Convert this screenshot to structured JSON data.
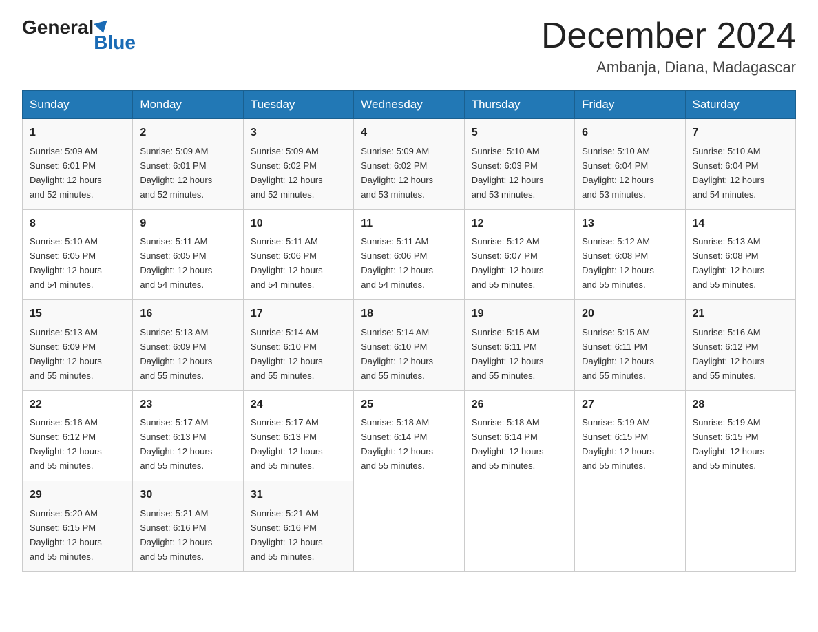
{
  "header": {
    "logo_general": "General",
    "logo_blue": "Blue",
    "month_title": "December 2024",
    "location": "Ambanja, Diana, Madagascar"
  },
  "days_of_week": [
    "Sunday",
    "Monday",
    "Tuesday",
    "Wednesday",
    "Thursday",
    "Friday",
    "Saturday"
  ],
  "weeks": [
    [
      {
        "day": "1",
        "sunrise": "5:09 AM",
        "sunset": "6:01 PM",
        "daylight": "12 hours and 52 minutes."
      },
      {
        "day": "2",
        "sunrise": "5:09 AM",
        "sunset": "6:01 PM",
        "daylight": "12 hours and 52 minutes."
      },
      {
        "day": "3",
        "sunrise": "5:09 AM",
        "sunset": "6:02 PM",
        "daylight": "12 hours and 52 minutes."
      },
      {
        "day": "4",
        "sunrise": "5:09 AM",
        "sunset": "6:02 PM",
        "daylight": "12 hours and 53 minutes."
      },
      {
        "day": "5",
        "sunrise": "5:10 AM",
        "sunset": "6:03 PM",
        "daylight": "12 hours and 53 minutes."
      },
      {
        "day": "6",
        "sunrise": "5:10 AM",
        "sunset": "6:04 PM",
        "daylight": "12 hours and 53 minutes."
      },
      {
        "day": "7",
        "sunrise": "5:10 AM",
        "sunset": "6:04 PM",
        "daylight": "12 hours and 54 minutes."
      }
    ],
    [
      {
        "day": "8",
        "sunrise": "5:10 AM",
        "sunset": "6:05 PM",
        "daylight": "12 hours and 54 minutes."
      },
      {
        "day": "9",
        "sunrise": "5:11 AM",
        "sunset": "6:05 PM",
        "daylight": "12 hours and 54 minutes."
      },
      {
        "day": "10",
        "sunrise": "5:11 AM",
        "sunset": "6:06 PM",
        "daylight": "12 hours and 54 minutes."
      },
      {
        "day": "11",
        "sunrise": "5:11 AM",
        "sunset": "6:06 PM",
        "daylight": "12 hours and 54 minutes."
      },
      {
        "day": "12",
        "sunrise": "5:12 AM",
        "sunset": "6:07 PM",
        "daylight": "12 hours and 55 minutes."
      },
      {
        "day": "13",
        "sunrise": "5:12 AM",
        "sunset": "6:08 PM",
        "daylight": "12 hours and 55 minutes."
      },
      {
        "day": "14",
        "sunrise": "5:13 AM",
        "sunset": "6:08 PM",
        "daylight": "12 hours and 55 minutes."
      }
    ],
    [
      {
        "day": "15",
        "sunrise": "5:13 AM",
        "sunset": "6:09 PM",
        "daylight": "12 hours and 55 minutes."
      },
      {
        "day": "16",
        "sunrise": "5:13 AM",
        "sunset": "6:09 PM",
        "daylight": "12 hours and 55 minutes."
      },
      {
        "day": "17",
        "sunrise": "5:14 AM",
        "sunset": "6:10 PM",
        "daylight": "12 hours and 55 minutes."
      },
      {
        "day": "18",
        "sunrise": "5:14 AM",
        "sunset": "6:10 PM",
        "daylight": "12 hours and 55 minutes."
      },
      {
        "day": "19",
        "sunrise": "5:15 AM",
        "sunset": "6:11 PM",
        "daylight": "12 hours and 55 minutes."
      },
      {
        "day": "20",
        "sunrise": "5:15 AM",
        "sunset": "6:11 PM",
        "daylight": "12 hours and 55 minutes."
      },
      {
        "day": "21",
        "sunrise": "5:16 AM",
        "sunset": "6:12 PM",
        "daylight": "12 hours and 55 minutes."
      }
    ],
    [
      {
        "day": "22",
        "sunrise": "5:16 AM",
        "sunset": "6:12 PM",
        "daylight": "12 hours and 55 minutes."
      },
      {
        "day": "23",
        "sunrise": "5:17 AM",
        "sunset": "6:13 PM",
        "daylight": "12 hours and 55 minutes."
      },
      {
        "day": "24",
        "sunrise": "5:17 AM",
        "sunset": "6:13 PM",
        "daylight": "12 hours and 55 minutes."
      },
      {
        "day": "25",
        "sunrise": "5:18 AM",
        "sunset": "6:14 PM",
        "daylight": "12 hours and 55 minutes."
      },
      {
        "day": "26",
        "sunrise": "5:18 AM",
        "sunset": "6:14 PM",
        "daylight": "12 hours and 55 minutes."
      },
      {
        "day": "27",
        "sunrise": "5:19 AM",
        "sunset": "6:15 PM",
        "daylight": "12 hours and 55 minutes."
      },
      {
        "day": "28",
        "sunrise": "5:19 AM",
        "sunset": "6:15 PM",
        "daylight": "12 hours and 55 minutes."
      }
    ],
    [
      {
        "day": "29",
        "sunrise": "5:20 AM",
        "sunset": "6:15 PM",
        "daylight": "12 hours and 55 minutes."
      },
      {
        "day": "30",
        "sunrise": "5:21 AM",
        "sunset": "6:16 PM",
        "daylight": "12 hours and 55 minutes."
      },
      {
        "day": "31",
        "sunrise": "5:21 AM",
        "sunset": "6:16 PM",
        "daylight": "12 hours and 55 minutes."
      },
      null,
      null,
      null,
      null
    ]
  ],
  "labels": {
    "sunrise": "Sunrise:",
    "sunset": "Sunset:",
    "daylight": "Daylight:"
  }
}
